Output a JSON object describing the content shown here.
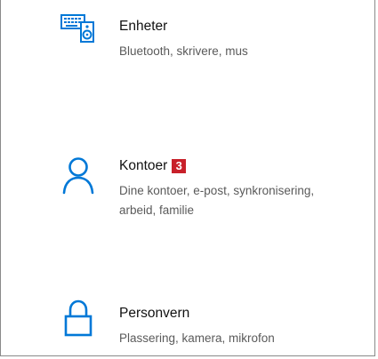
{
  "colors": {
    "accent": "#0078d7",
    "badge": "#c8202a",
    "title": "#111111",
    "description": "#5a5a5a"
  },
  "items": [
    {
      "title": "Enheter",
      "description": "Bluetooth, skrivere, mus",
      "icon": "devices-icon"
    },
    {
      "title": "Kontoer",
      "badge": "3",
      "description": "Dine kontoer, e-post, synkronisering, arbeid, familie",
      "icon": "person-icon"
    },
    {
      "title": "Personvern",
      "description": "Plassering, kamera, mikrofon",
      "icon": "lock-icon"
    }
  ]
}
